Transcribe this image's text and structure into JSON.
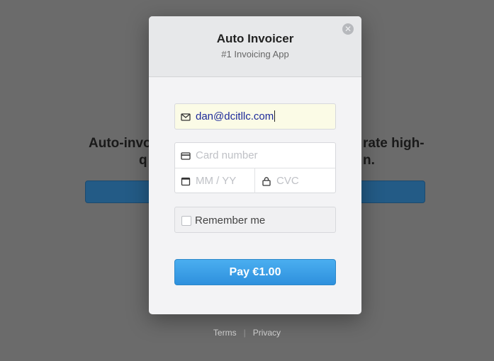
{
  "background": {
    "headline_line1_left": "Auto-invo",
    "headline_line1_right": "rate high-",
    "headline_line2_left": "q",
    "headline_line2_right": "n.",
    "footer": {
      "terms": "Terms",
      "separator": "|",
      "privacy": "Privacy"
    }
  },
  "modal": {
    "title": "Auto Invoicer",
    "subtitle": "#1 Invoicing App",
    "close_icon": "close-icon",
    "email": {
      "value": "dan@dcitllc.com",
      "icon": "envelope-icon"
    },
    "card_number": {
      "placeholder": "Card number",
      "icon": "credit-card-icon"
    },
    "expiry": {
      "placeholder": "MM / YY",
      "icon": "calendar-icon"
    },
    "cvc": {
      "placeholder": "CVC",
      "icon": "lock-icon"
    },
    "remember_label": "Remember me",
    "pay_label": "Pay €1.00"
  },
  "colors": {
    "pay_button": "#3a9fe6",
    "email_field_bg": "#fbfbe6",
    "overlay": "#6b6b6b"
  }
}
